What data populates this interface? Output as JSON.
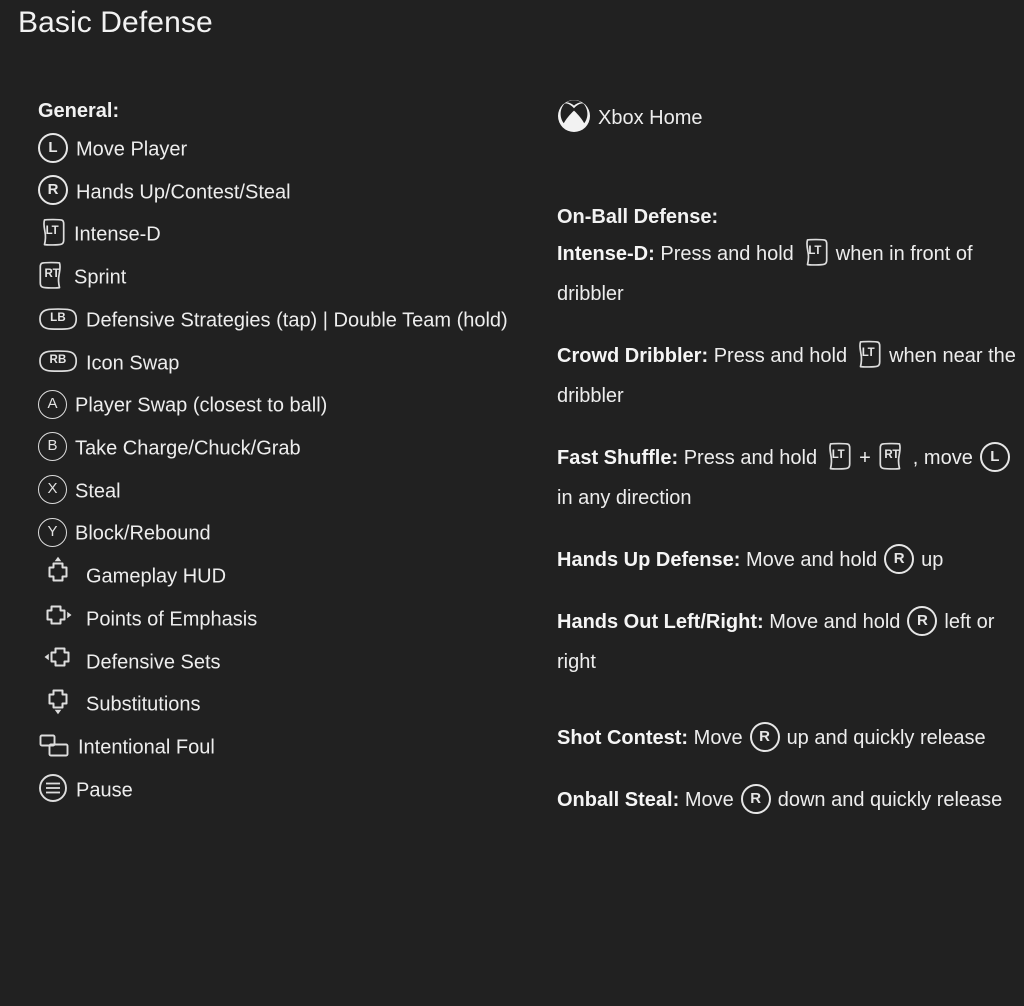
{
  "page": {
    "title": "Basic Defense",
    "background_color": "#212121",
    "text_color": "#ededed"
  },
  "left_column": {
    "heading": "General:",
    "items": [
      {
        "icon": "left-stick-icon",
        "glyph": "L",
        "label": "Move Player"
      },
      {
        "icon": "right-stick-icon",
        "glyph": "R",
        "label": "Hands Up/Contest/Steal"
      },
      {
        "icon": "left-trigger-icon",
        "glyph": "LT",
        "label": "Intense-D"
      },
      {
        "icon": "right-trigger-icon",
        "glyph": "RT",
        "label": "Sprint"
      },
      {
        "icon": "left-bumper-icon",
        "glyph": "LB",
        "label": "Defensive Strategies (tap) | Double Team (hold)"
      },
      {
        "icon": "right-bumper-icon",
        "glyph": "RB",
        "label": "Icon Swap"
      },
      {
        "icon": "a-button-icon",
        "glyph": "A",
        "label": "Player Swap (closest to ball)"
      },
      {
        "icon": "b-button-icon",
        "glyph": "B",
        "label": "Take Charge/Chuck/Grab"
      },
      {
        "icon": "x-button-icon",
        "glyph": "X",
        "label": "Steal"
      },
      {
        "icon": "y-button-icon",
        "glyph": "Y",
        "label": "Block/Rebound"
      },
      {
        "icon": "dpad-up-icon",
        "glyph": "D-Pad Up",
        "label": "Gameplay HUD"
      },
      {
        "icon": "dpad-right-icon",
        "glyph": "D-Pad Right",
        "label": "Points of Emphasis"
      },
      {
        "icon": "dpad-left-icon",
        "glyph": "D-Pad Left",
        "label": "Defensive Sets"
      },
      {
        "icon": "dpad-down-icon",
        "glyph": "D-Pad Down",
        "label": "Substitutions"
      },
      {
        "icon": "view-button-icon",
        "glyph": "View",
        "label": "Intentional Foul"
      },
      {
        "icon": "menu-button-icon",
        "glyph": "Menu",
        "label": "Pause"
      }
    ]
  },
  "right_column": {
    "guide": {
      "icon": "xbox-guide-icon",
      "label": "Xbox Home"
    },
    "heading": "On-Ball Defense:",
    "moves": [
      {
        "name": "Intense-D:",
        "part1": "Press and hold",
        "icon1": "left-trigger-icon",
        "glyph1": "LT",
        "part2": "when in front of dribbler"
      },
      {
        "name": "Crowd Dribbler:",
        "part1": "Press and hold",
        "icon1": "left-trigger-icon",
        "glyph1": "LT",
        "part2": "when near the dribbler"
      },
      {
        "name": "Fast Shuffle:",
        "part1": "Press and hold",
        "icon1": "left-trigger-icon",
        "glyph1": "LT",
        "plus": "+",
        "icon2": "right-trigger-icon",
        "glyph2": "RT",
        "part2": ", move",
        "icon3": "left-stick-icon",
        "glyph3": "L",
        "part3": "in any direction"
      },
      {
        "name": "Hands Up Defense:",
        "part1": "Move and hold",
        "icon1": "right-stick-icon",
        "glyph1": "R",
        "part2": "up"
      },
      {
        "name": "Hands Out Left/Right:",
        "part1": "Move and hold",
        "icon1": "right-stick-icon",
        "glyph1": "R",
        "part2": "left or right"
      },
      {
        "name": "Shot Contest:",
        "part1": "Move",
        "icon1": "right-stick-icon",
        "glyph1": "R",
        "part2": "up and quickly release"
      },
      {
        "name": "Onball Steal:",
        "part1": "Move",
        "icon1": "right-stick-icon",
        "glyph1": "R",
        "part2": "down and quickly release"
      }
    ]
  }
}
